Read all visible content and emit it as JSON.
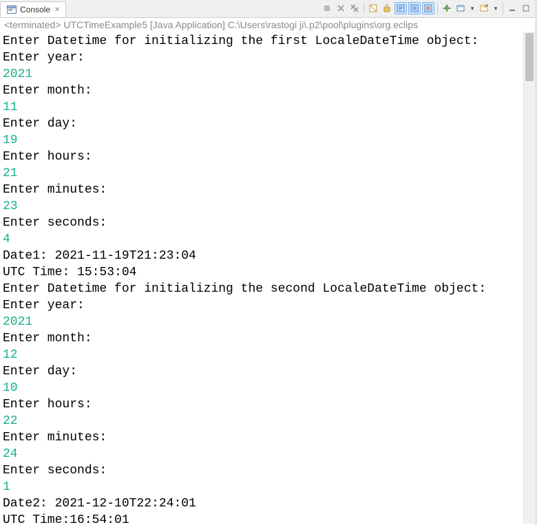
{
  "tab": {
    "title": "Console",
    "close_glyph": "✕"
  },
  "status": {
    "text": "<terminated> UTCTimeExample5 [Java Application] C:\\Users\\rastogi ji\\.p2\\pool\\plugins\\org.eclips"
  },
  "lines": [
    {
      "text": "Enter Datetime for initializing the first LocaleDateTime object:",
      "input": false
    },
    {
      "text": "Enter year:",
      "input": false
    },
    {
      "text": "2021",
      "input": true
    },
    {
      "text": "Enter month:",
      "input": false
    },
    {
      "text": "11",
      "input": true
    },
    {
      "text": "Enter day:",
      "input": false
    },
    {
      "text": "19",
      "input": true
    },
    {
      "text": "Enter hours:",
      "input": false
    },
    {
      "text": "21",
      "input": true
    },
    {
      "text": "Enter minutes:",
      "input": false
    },
    {
      "text": "23",
      "input": true
    },
    {
      "text": "Enter seconds:",
      "input": false
    },
    {
      "text": "4",
      "input": true
    },
    {
      "text": "Date1: 2021-11-19T21:23:04",
      "input": false
    },
    {
      "text": "UTC Time: 15:53:04",
      "input": false
    },
    {
      "text": "Enter Datetime for initializing the second LocaleDateTime object:",
      "input": false
    },
    {
      "text": "Enter year:",
      "input": false
    },
    {
      "text": "2021",
      "input": true
    },
    {
      "text": "Enter month:",
      "input": false
    },
    {
      "text": "12",
      "input": true
    },
    {
      "text": "Enter day:",
      "input": false
    },
    {
      "text": "10",
      "input": true
    },
    {
      "text": "Enter hours:",
      "input": false
    },
    {
      "text": "22",
      "input": true
    },
    {
      "text": "Enter minutes:",
      "input": false
    },
    {
      "text": "24",
      "input": true
    },
    {
      "text": "Enter seconds:",
      "input": false
    },
    {
      "text": "1",
      "input": true
    },
    {
      "text": "Date2: 2021-12-10T22:24:01",
      "input": false
    },
    {
      "text": "UTC Time:16:54:01",
      "input": false
    }
  ]
}
